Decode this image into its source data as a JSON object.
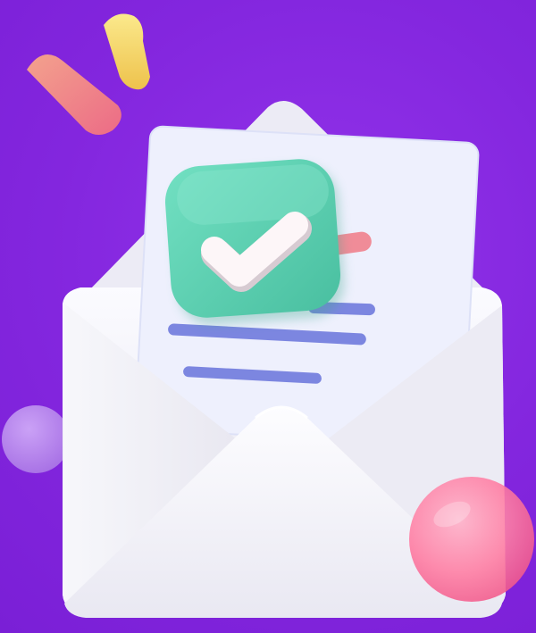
{
  "scene": {
    "subject": "open-envelope-with-checked-letter",
    "icons": [
      "envelope-icon",
      "letter-icon",
      "checkmark-icon"
    ],
    "colors": {
      "background": "#8a2be2",
      "envelope": "#f2f1f8",
      "letter": "#eceefc",
      "check_badge": "#5fd3b5",
      "check_mark": "#fbf4f6",
      "lines": "#7c86e0",
      "confetti_pink": "#f07e8e",
      "confetti_yellow": "#f6d86a",
      "bubble_pink": "#ff7ea6",
      "bubble_lavender": "#c7a2f2"
    }
  }
}
